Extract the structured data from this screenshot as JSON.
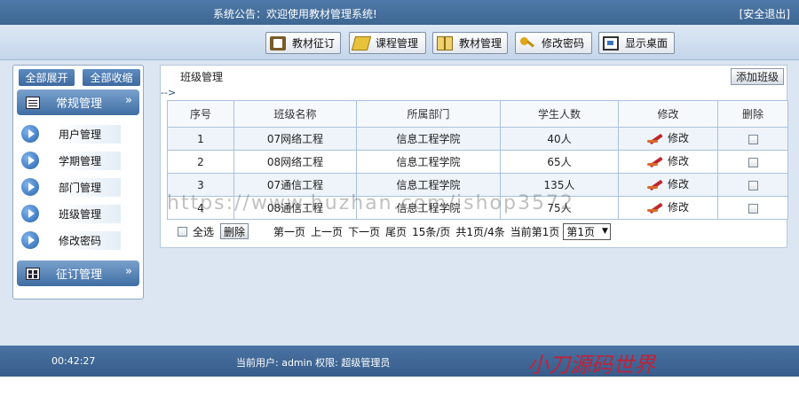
{
  "topbar": {
    "announcement": "系统公告：欢迎使用教材管理系统!",
    "logout": "[安全退出]"
  },
  "toolbar": {
    "buttons": [
      {
        "label": "教材征订",
        "icon": "book-icon"
      },
      {
        "label": "课程管理",
        "icon": "tag-icon"
      },
      {
        "label": "教材管理",
        "icon": "open-book-icon"
      },
      {
        "label": "修改密码",
        "icon": "key-icon"
      },
      {
        "label": "显示桌面",
        "icon": "desktop-icon"
      }
    ]
  },
  "sidebar": {
    "expand_all": "全部展开",
    "collapse_all": "全部收缩",
    "section1": {
      "title": "常规管理",
      "chevron": "»"
    },
    "items": [
      {
        "label": "用户管理"
      },
      {
        "label": "学期管理"
      },
      {
        "label": "部门管理"
      },
      {
        "label": "班级管理"
      },
      {
        "label": "修改密码"
      }
    ],
    "section2": {
      "title": "征订管理",
      "chevron": "»"
    }
  },
  "main": {
    "title": "班级管理",
    "arrow_fragment": "-->",
    "add_button": "添加班级",
    "columns": [
      "序号",
      "班级名称",
      "所属部门",
      "学生人数",
      "修改",
      "删除"
    ],
    "rows": [
      {
        "no": "1",
        "name": "07网络工程",
        "dept": "信息工程学院",
        "count": "40人",
        "edit": "修改"
      },
      {
        "no": "2",
        "name": "08网络工程",
        "dept": "信息工程学院",
        "count": "65人",
        "edit": "修改"
      },
      {
        "no": "3",
        "name": "07通信工程",
        "dept": "信息工程学院",
        "count": "135人",
        "edit": "修改"
      },
      {
        "no": "4",
        "name": "08通信工程",
        "dept": "信息工程学院",
        "count": "75人",
        "edit": "修改"
      }
    ],
    "pager": {
      "select_all": "全选",
      "delete": "删除",
      "first": "第一页",
      "prev": "上一页",
      "next": "下一页",
      "last": "尾页",
      "per_page": "15条/页",
      "total": "共1页/4条",
      "current": "当前第1页",
      "page_select": "第1页"
    }
  },
  "watermark": "https://www.huzhan.com/ishop3572",
  "footer": {
    "clock": "00:42:27",
    "current_user": "当前用户: admin   权限: 超级管理员",
    "brand": "小刀源码世界"
  }
}
